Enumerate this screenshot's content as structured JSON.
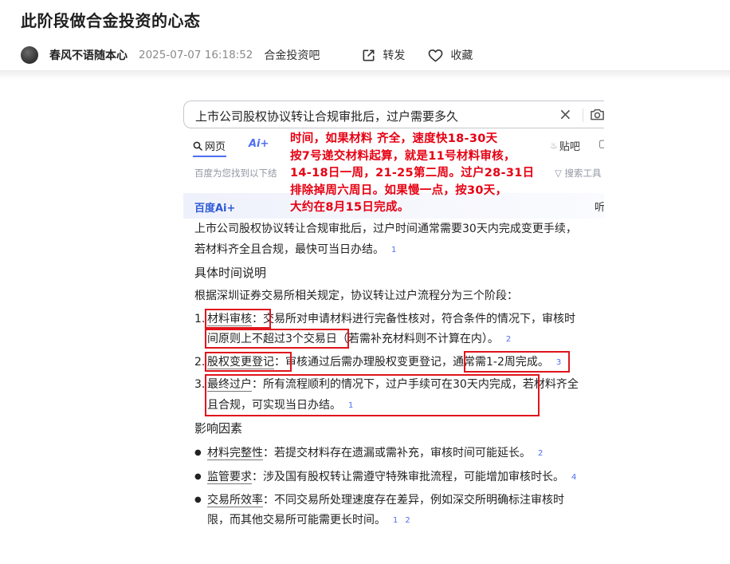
{
  "post": {
    "title": "此阶段做合金投资的心态",
    "author": "春风不语随本心",
    "time": "2025-07-07 16:18:52",
    "bar": "合金投资吧",
    "share_label": "转发",
    "fav_label": "收藏"
  },
  "search": {
    "query": "上市公司股权协议转让合规审批后，过户需要多久",
    "clear": "×",
    "tabs": {
      "web": "网页",
      "ai": "Ai+",
      "tieba": "贴吧",
      "more": "▢"
    },
    "found_text": "百度为您找到以下结",
    "tools_label": "搜索工具",
    "ai_logo": "百度Ai+",
    "ai_more": "听"
  },
  "answer": {
    "intro_1": "上市公司股权协议转让合规审批后，过户时间通常需要30天内完成变更手续，",
    "intro_2": "若材料齐全且合规，最快可当日办结。",
    "ref_intro": "1",
    "section1_title": "具体时间说明",
    "section1_lead": "根据深圳证券交易所相关规定，协议转让过户流程分为三个阶段：",
    "steps": [
      {
        "num": "1.",
        "title": "材料审核",
        "text_a": "：交易所对申请材料进行完备性核对，符合条件的情况下，审核时",
        "text_b": "间原则上不超过3个交易日（若需补充材料则不计算在内）。",
        "ref": "2"
      },
      {
        "num": "2.",
        "title": "股权变更登记",
        "text_a": "：审核通过后需办理股权变更登记，通常需1-2周完成。",
        "ref": "3"
      },
      {
        "num": "3.",
        "title": "最终过户",
        "text_a": "：所有流程顺利的情况下，过户手续可在30天内完成，若材料齐全",
        "text_b": "且合规，可实现当日办结。",
        "ref": "1"
      }
    ],
    "section2_title": "影响因素",
    "factors": [
      {
        "title": "材料完整性",
        "text": "：若提交材料存在遗漏或需补充，审核时间可能延长。",
        "refs": "2"
      },
      {
        "title": "监管要求",
        "text": "：涉及国有股权转让需遵守特殊审批流程，可能增加审核时长。",
        "refs": "4"
      },
      {
        "title": "交易所效率",
        "text_a": "：不同交易所处理速度存在差异，例如深交所明确标注审核时",
        "text_b": "限，而其他交易所可能需更长时间。",
        "ref1": "1",
        "ref2": "2"
      }
    ]
  },
  "annotation": {
    "lines": [
      "时间，如果材料 齐全，速度快18-30天",
      "按7号递交材料起算，就是11号材料审核，",
      "14-18日一周，21-25第二周。过户28-31日",
      "排除掉周六周日。如果慢一点，按30天，",
      "大约在8月15日完成。"
    ],
    "color": "#e60012"
  },
  "icons": {
    "share": "share-icon",
    "favorite": "heart-icon",
    "search_tab": "search-icon",
    "camera": "camera-icon",
    "tools_filter": "filter-icon"
  }
}
